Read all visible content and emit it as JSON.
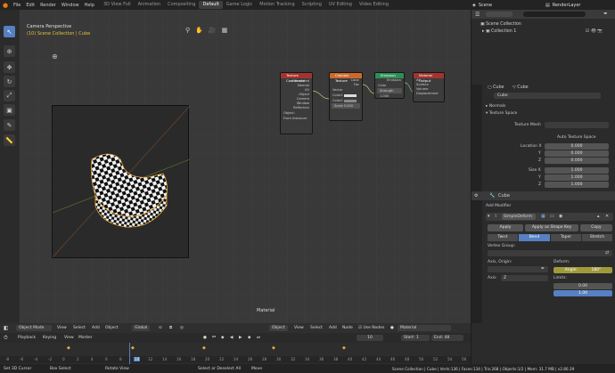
{
  "topbar": {
    "menu": [
      "File",
      "Edit",
      "Render",
      "Window",
      "Help"
    ],
    "workspaces": [
      "3D View Full",
      "Animation",
      "Compositing",
      "Default",
      "Game Logic",
      "Motion Tracking",
      "Scripting",
      "UV Editing",
      "Video Editing"
    ],
    "active_workspace": "Default",
    "scene": "Scene",
    "render_layer": "RenderLayer"
  },
  "viewport": {
    "camera_label": "Camera Perspective",
    "collection_label": "(10) Scene Collection | Cube",
    "footer_label": "Material"
  },
  "nodes": {
    "texcoord": {
      "title": "Texture Coordinate",
      "outputs": [
        "Generated",
        "Normal",
        "UV",
        "Object",
        "Camera",
        "Window",
        "Reflection"
      ],
      "object_label": "Object:",
      "from_instancer": "From Instancer"
    },
    "checker": {
      "title": "Checker Texture",
      "outputs": [
        "Color",
        "Fac"
      ],
      "inputs": [
        "Vector",
        "Color1",
        "Color2",
        "Scale"
      ],
      "scale_value": "5.000"
    },
    "emission": {
      "title": "Emission",
      "output": "Emission",
      "inputs": [
        "Color",
        "Strength"
      ],
      "strength_value": "1.000"
    },
    "matout": {
      "title": "Material Output",
      "option": "All",
      "inputs": [
        "Surface",
        "Volume",
        "Displacement"
      ]
    }
  },
  "outliner": {
    "root": "Scene Collection",
    "child": "Collection 1"
  },
  "props1": {
    "object": "Cube",
    "mesh": "Cube",
    "mesh_field": "Cube",
    "normals": "Normals",
    "texture_space": "Texture Space",
    "texture_mesh_label": "Texture Mesh",
    "auto_texture_space": "Auto Texture Space",
    "location_label": "Location X",
    "location": [
      "0.000",
      "0.000",
      "0.000"
    ],
    "size_label": "Size X",
    "size": [
      "1.000",
      "1.000",
      "1.000"
    ],
    "axes": [
      "Y",
      "Z"
    ]
  },
  "props2": {
    "object": "Cube",
    "add_modifier": "Add Modifier",
    "modifier_name": "SimpleDeform",
    "apply": "Apply",
    "apply_shape": "Apply as Shape Key",
    "copy": "Copy",
    "tabs": [
      "Twist",
      "Bend",
      "Taper",
      "Stretch"
    ],
    "active_tab": "Bend",
    "vertex_group": "Vertex Group:",
    "axis_origin": "Axis, Origin:",
    "deform": "Deform:",
    "angle_label": "Angle:",
    "angle_value": "180°",
    "axis_label": "Axis:",
    "axis_value": "Z",
    "limits": "Limits:",
    "limit_low": "0.00",
    "limit_high": "1.00"
  },
  "viewport_header": {
    "mode": "Object Mode",
    "menus": [
      "View",
      "Select",
      "Add",
      "Object"
    ],
    "orientation": "Global"
  },
  "node_header": {
    "object": "Object",
    "menus": [
      "View",
      "Select",
      "Add",
      "Node"
    ],
    "use_nodes": "Use Nodes",
    "material": "Material"
  },
  "timeline": {
    "menus": [
      "Playback",
      "Keying",
      "View",
      "Marker"
    ],
    "current_frame": "10",
    "start_label": "Start:",
    "start_value": "1",
    "end_label": "End:",
    "end_value": "48",
    "ticks": [
      "-8",
      "-6",
      "-4",
      "-2",
      "0",
      "2",
      "4",
      "6",
      "8",
      "10",
      "12",
      "14",
      "16",
      "18",
      "20",
      "22",
      "24",
      "26",
      "28",
      "30",
      "32",
      "34",
      "36",
      "38",
      "40",
      "42",
      "44",
      "46",
      "48",
      "50",
      "52",
      "54",
      "56"
    ]
  },
  "status": {
    "left1": "Set 3D Cursor",
    "left2": "Box Select",
    "left3": "Rotate View",
    "mid1": "Select or Deselect All",
    "mid2": "Move",
    "stats": "Scene Collection | Cube | Verts:136 | Faces:134 | Tris:268 | Objects:1/2 | Mem: 31.7 MB | v2.80.39"
  }
}
